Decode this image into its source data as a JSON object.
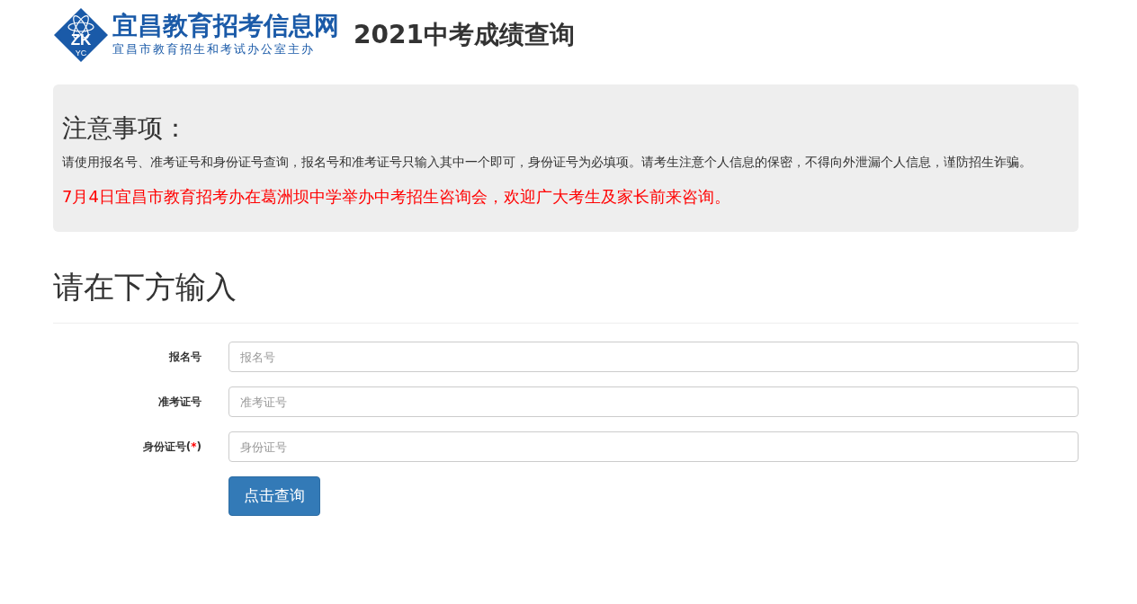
{
  "header": {
    "logo": {
      "badge_letters": "ZK",
      "badge_sub": "YC",
      "site_name": "宜昌教育招考信息网",
      "sponsor": "宜昌市教育招生和考试办公室主办"
    },
    "title": "2021中考成绩查询"
  },
  "notice": {
    "heading": "注意事项：",
    "body": "请使用报名号、准考证号和身份证号查询，报名号和准考证号只输入其中一个即可，身份证号为必填项。请考生注意个人信息的保密，不得向外泄漏个人信息，谨防招生诈骗。",
    "announcement": "7月4日宜昌市教育招考办在葛洲坝中学举办中考招生咨询会，欢迎广大考生及家长前来咨询。"
  },
  "form": {
    "heading": "请在下方输入",
    "fields": [
      {
        "label": "报名号",
        "placeholder": "报名号"
      },
      {
        "label": "准考证号",
        "placeholder": "准考证号"
      },
      {
        "label": "身份证号(",
        "required_mark": "*",
        "label_end": ")",
        "placeholder": "身份证号"
      }
    ],
    "submit": "点击查询"
  }
}
